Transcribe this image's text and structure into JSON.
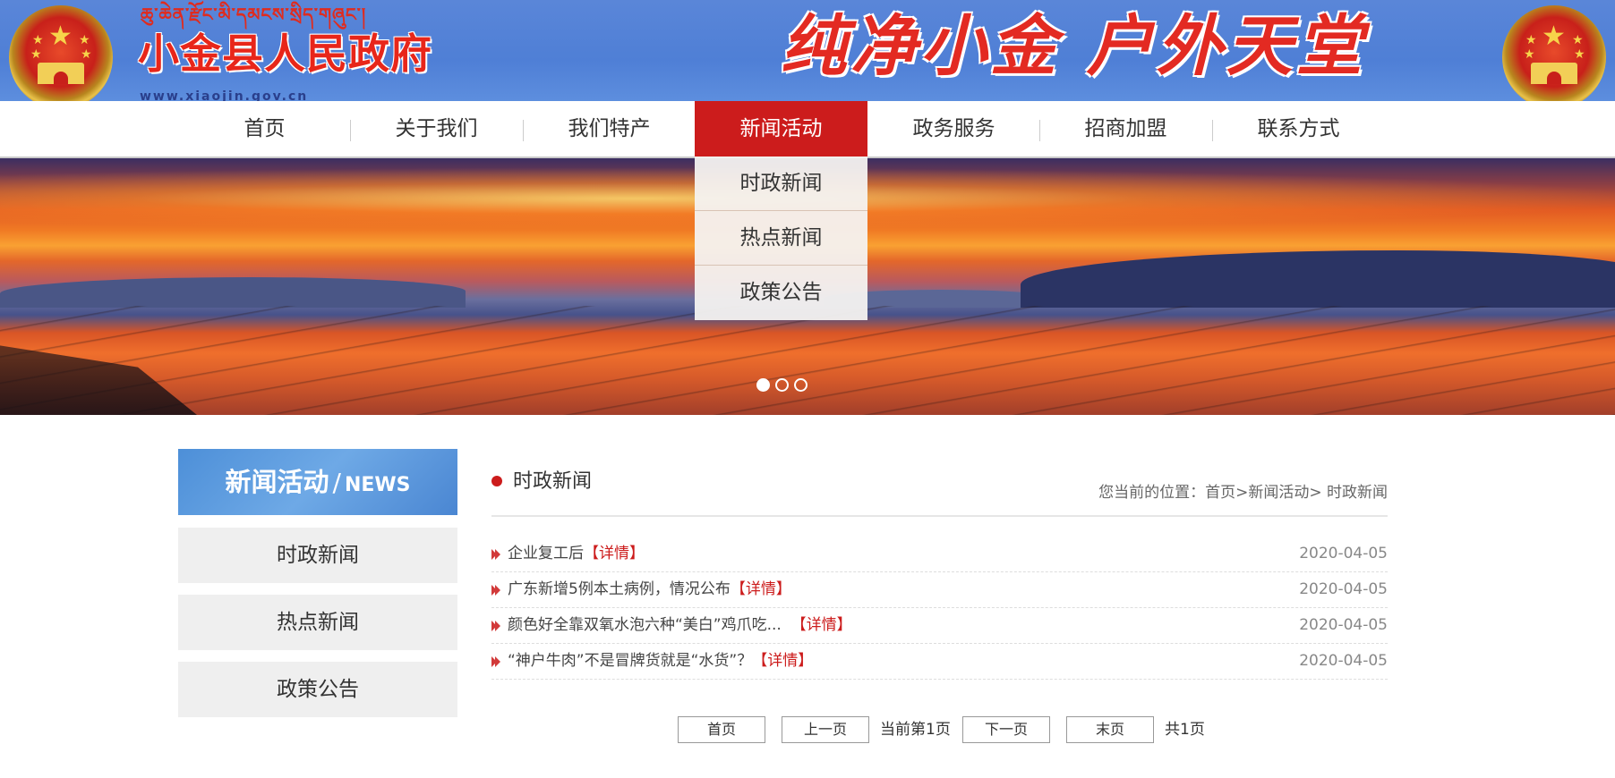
{
  "header": {
    "tibetan_text": "ཆུ་ཆེན་རྫོང་མི་དམངས་སྲིད་གཞུང་།",
    "site_name": "小金县人民政府",
    "site_url": "www.xiaojin.gov.cn",
    "slogan": "纯净小金 户外天堂"
  },
  "nav": {
    "items": [
      "首页",
      "关于我们",
      "我们特产",
      "新闻活动",
      "政务服务",
      "招商加盟",
      "联系方式"
    ],
    "active_index": 3,
    "dropdown": [
      "时政新闻",
      "热点新闻",
      "政策公告"
    ]
  },
  "banner": {
    "slide_count": 3,
    "active_slide": 0
  },
  "sidebar": {
    "heading_cn": "新闻活动",
    "heading_slash": "/",
    "heading_en": "NEWS",
    "items": [
      "时政新闻",
      "热点新闻",
      "政策公告"
    ]
  },
  "content": {
    "title": "时政新闻",
    "breadcrumb": "您当前的位置：首页>新闻活动> 时政新闻",
    "detail_label": "【详情】",
    "news": [
      {
        "title": "企业复工后",
        "date": "2020-04-05"
      },
      {
        "title": "广东新增5例本土病例，情况公布",
        "date": "2020-04-05"
      },
      {
        "title": "颜色好全靠双氧水泡六种“美白”鸡爪吃...",
        "date": "2020-04-05"
      },
      {
        "title": "“神户牛肉”不是冒牌货就是“水货”？",
        "date": "2020-04-05"
      }
    ]
  },
  "pagination": {
    "first": "首页",
    "prev": "上一页",
    "current": "当前第1页",
    "next": "下一页",
    "last": "末页",
    "total": "共1页"
  },
  "colors": {
    "header_blue": "#5a86d8",
    "accent_red": "#cc1c1c",
    "sidebar_head_blue": "#4d8fd8",
    "sidebar_item_bg": "#efefef"
  }
}
